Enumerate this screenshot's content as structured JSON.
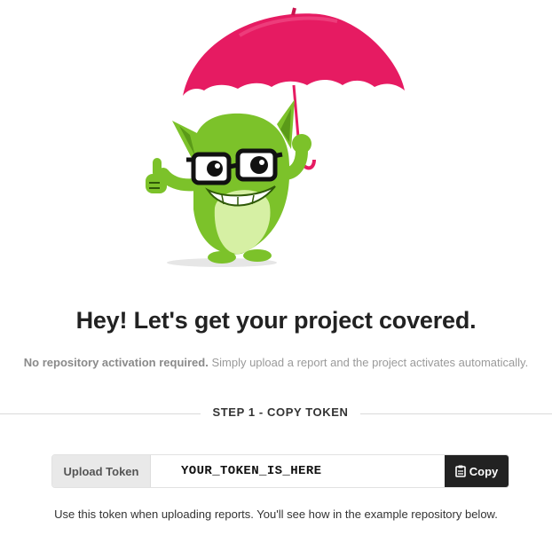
{
  "hero": {
    "illustration": "mascot-with-umbrella",
    "title": "Hey! Let's get your project covered.",
    "subtitle_strong": "No repository activation required.",
    "subtitle_rest": " Simply upload a report and the project activates automatically."
  },
  "step": {
    "label": "STEP 1 - COPY TOKEN"
  },
  "token": {
    "label": "Upload Token",
    "value": "YOUR_TOKEN_IS_HERE",
    "copy_label": "Copy",
    "copy_icon": "clipboard-icon"
  },
  "helper_text": "Use this token when uploading reports. You'll see how in the example repository below.",
  "colors": {
    "umbrella": "#e61b62",
    "mascot_green": "#7cc22a",
    "mascot_belly": "#d6f0a4",
    "button_dark": "#222222",
    "label_bg": "#e9e9e9"
  }
}
